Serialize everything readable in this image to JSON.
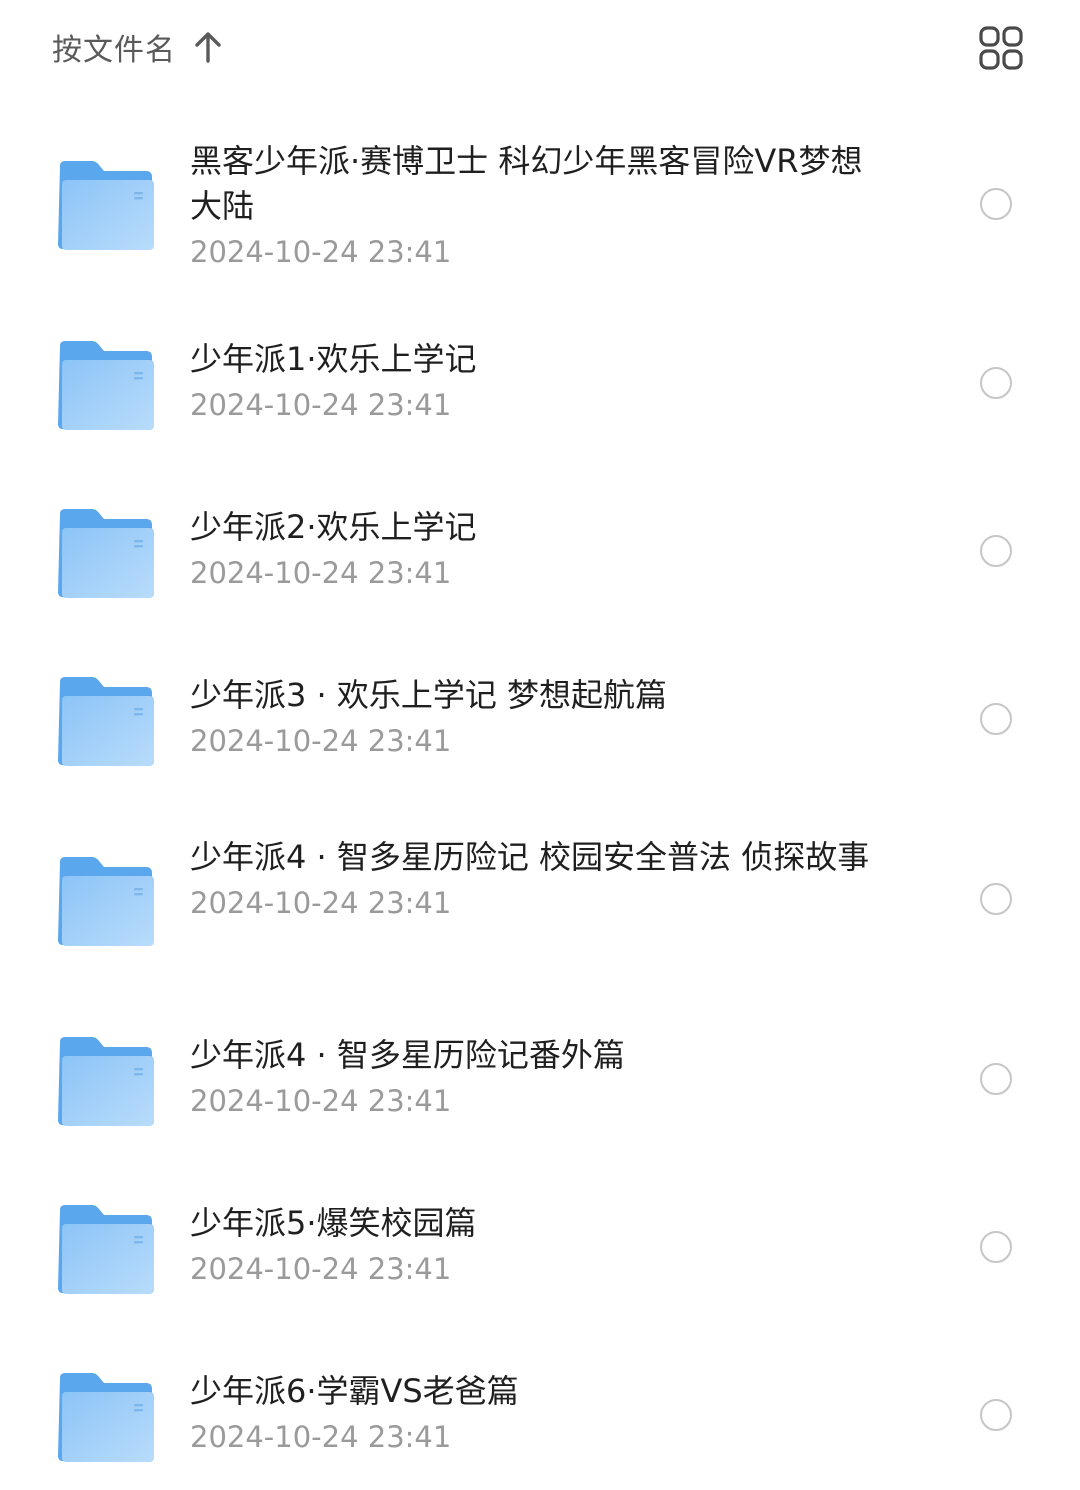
{
  "toolbar": {
    "sort_label": "按文件名",
    "sort_direction_icon": "arrow-up-icon",
    "view_toggle_icon": "grid-view-icon"
  },
  "colors": {
    "folder_front": "#8cc4f7",
    "folder_back": "#5ba7ee",
    "date_text": "#9a9a9a",
    "checkbox_border": "#c6c6c6"
  },
  "files": [
    {
      "name": "黑客少年派·赛博卫士  科幻少年黑客冒险VR梦想大陆",
      "date": "2024-10-24 23:41",
      "icon": "folder-icon",
      "selected": false
    },
    {
      "name": "少年派1·欢乐上学记",
      "date": "2024-10-24 23:41",
      "icon": "folder-icon",
      "selected": false
    },
    {
      "name": "少年派2·欢乐上学记",
      "date": "2024-10-24 23:41",
      "icon": "folder-icon",
      "selected": false
    },
    {
      "name": "少年派3 · 欢乐上学记  梦想起航篇",
      "date": "2024-10-24 23:41",
      "icon": "folder-icon",
      "selected": false
    },
    {
      "name": "少年派4 · 智多星历险记  校园安全普法  侦探故事",
      "date": "2024-10-24 23:41",
      "icon": "folder-icon",
      "selected": false
    },
    {
      "name": "少年派4 · 智多星历险记番外篇",
      "date": "2024-10-24 23:41",
      "icon": "folder-icon",
      "selected": false
    },
    {
      "name": "少年派5·爆笑校园篇",
      "date": "2024-10-24 23:41",
      "icon": "folder-icon",
      "selected": false
    },
    {
      "name": "少年派6·学霸VS老爸篇",
      "date": "2024-10-24 23:41",
      "icon": "folder-icon",
      "selected": false
    }
  ]
}
